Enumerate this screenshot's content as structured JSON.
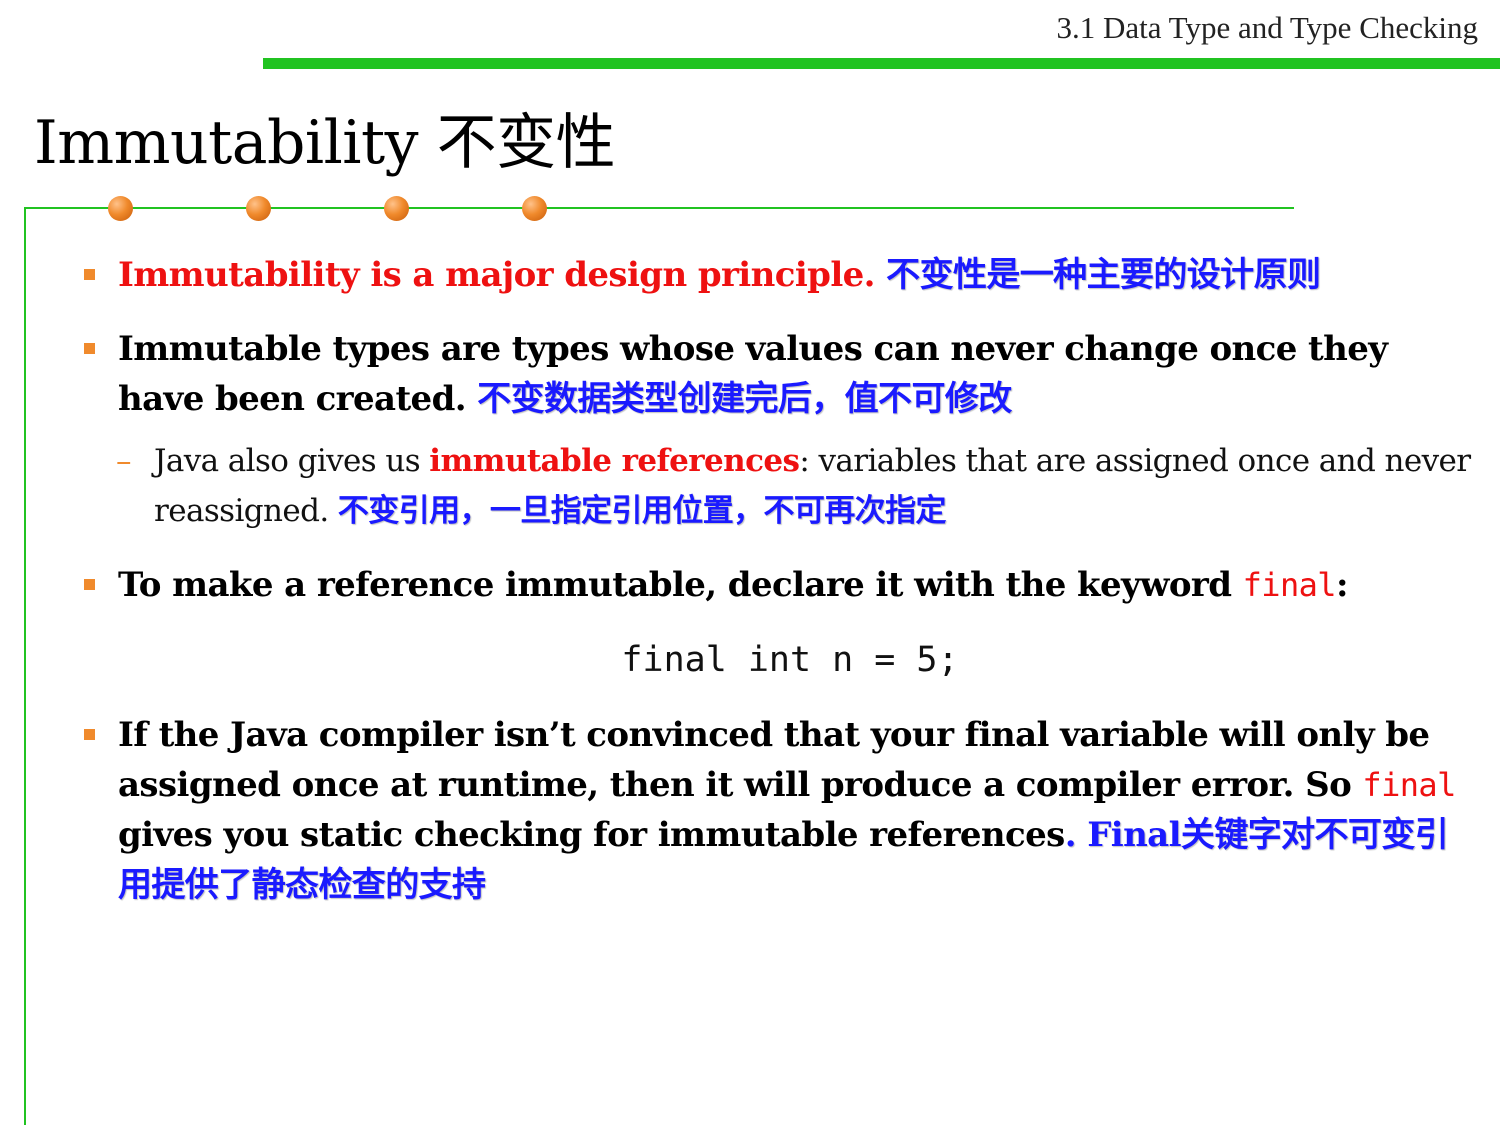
{
  "header": {
    "section_title": "3.1 Data Type and Type Checking"
  },
  "slide": {
    "title": "Immutability 不变性"
  },
  "bullets": {
    "b1_en": "Immutability is a major design principle.",
    "b1_cn": "不变性是一种主要的设计原则",
    "b2_en": "Immutable types are types whose values can never change once they have been created.",
    "b2_cn": "不变数据类型创建完后，值不可修改",
    "sub_pre": "Java also gives us ",
    "sub_highlight": "immutable references",
    "sub_post": ": variables that are assigned once and never reassigned.",
    "sub_cn": "不变引用，一旦指定引用位置，不可再次指定",
    "b3_pre": "To make a reference immutable, declare it with the keyword ",
    "b3_keyword": "final",
    "b3_post": ":",
    "code_line": "final int n = 5;",
    "b4_en": "If the Java compiler isn’t convinced that your final variable will only be assigned once at runtime, then it will produce a compiler error. So ",
    "b4_keyword": "final",
    "b4_en2": " gives you static checking for immutable references",
    "b4_cn": ". Final关键字对不可变引用提供了静态检查的支持"
  },
  "colors": {
    "accent_green": "#21c321",
    "bullet_orange": "#f08a2c",
    "emphasis_red": "#ee1111",
    "chinese_blue": "#1a1aff"
  }
}
